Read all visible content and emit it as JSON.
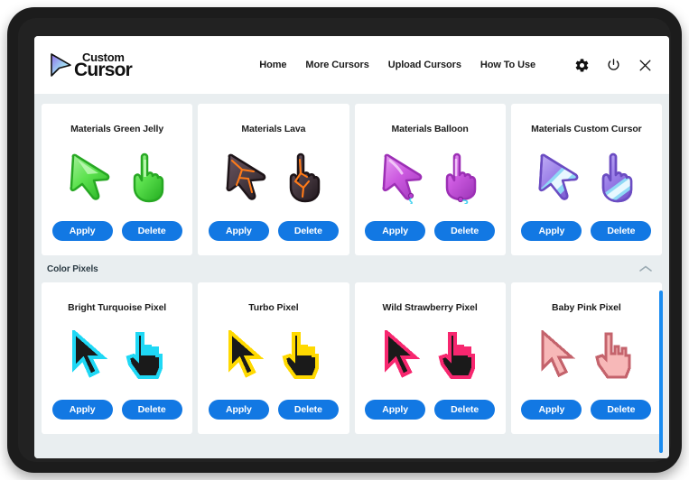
{
  "app": {
    "brand_top": "Custom",
    "brand_bottom": "Cursor",
    "logo_icon": "cursor-arrow-logo"
  },
  "header": {
    "nav": [
      {
        "label": "Home",
        "name": "nav-home"
      },
      {
        "label": "More Cursors",
        "name": "nav-more-cursors"
      },
      {
        "label": "Upload Cursors",
        "name": "nav-upload-cursors"
      },
      {
        "label": "How To Use",
        "name": "nav-how-to-use"
      }
    ],
    "icons": [
      {
        "name": "gear-icon",
        "title": "Settings"
      },
      {
        "name": "power-icon",
        "title": "Power"
      },
      {
        "name": "close-icon",
        "title": "Close"
      }
    ]
  },
  "buttons": {
    "apply_label": "Apply",
    "delete_label": "Delete",
    "accent_color": "#1278e3"
  },
  "sections": [
    {
      "name": "materials-section",
      "label": "",
      "has_header": false,
      "cards": [
        {
          "title": "Materials Green Jelly",
          "style": "jelly",
          "fill": "#5de24f",
          "fill_light": "#a5f09b",
          "fill_dark": "#2fb82a",
          "outline": "#27a823",
          "accent": "#c9fbc0"
        },
        {
          "title": "Materials Lava",
          "style": "jelly",
          "fill": "#4a3c44",
          "fill_light": "#6b5560",
          "fill_dark": "#2a2026",
          "outline": "#1d1418",
          "accent": "#ff7a18"
        },
        {
          "title": "Materials Balloon",
          "style": "jelly",
          "fill": "#cc5ae0",
          "fill_light": "#e79df2",
          "fill_dark": "#a63cc0",
          "outline": "#9c2fb5",
          "accent": "#49d4f0"
        },
        {
          "title": "Materials Custom Cursor",
          "style": "jelly",
          "fill": "#9a7ee8",
          "fill_light": "#c0aef5",
          "fill_dark": "#7a5cd0",
          "outline": "#6b4cc2",
          "accent": "#8fd8f5"
        }
      ]
    },
    {
      "name": "color-pixels-section",
      "label": "Color Pixels",
      "has_header": true,
      "toggle_icon": "chevron-up-icon",
      "cards": [
        {
          "title": "Bright Turquoise Pixel",
          "style": "pixel",
          "fill": "#1a1a1a",
          "outline": "#1fd8f5"
        },
        {
          "title": "Turbo Pixel",
          "style": "pixel",
          "fill": "#1a1a1a",
          "outline": "#ffd900"
        },
        {
          "title": "Wild Strawberry Pixel",
          "style": "pixel",
          "fill": "#1a1a1a",
          "outline": "#f7276f"
        },
        {
          "title": "Baby Pink Pixel",
          "style": "pixel",
          "fill": "#f7b8b8",
          "outline": "#c4636c"
        }
      ]
    }
  ],
  "scrollbar": {
    "name": "vertical-scrollbar",
    "color": "#1a8cf0"
  }
}
